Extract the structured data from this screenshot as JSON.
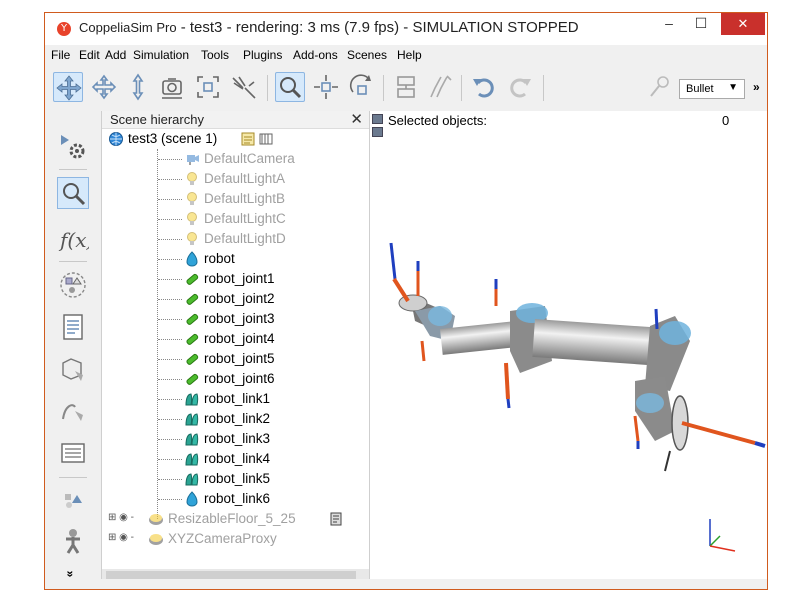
{
  "window": {
    "app_name": "CoppeliaSim Pro",
    "title_rest": " - test3 - rendering: 3 ms (7.9 fps) - SIMULATION STOPPED",
    "minimize": "–",
    "maximize": "☐",
    "close": "✕"
  },
  "menu": [
    "File",
    "Edit",
    "Add",
    "Simulation",
    "Tools",
    "Plugins",
    "Add-ons",
    "Scenes",
    "Help"
  ],
  "toolbar": {
    "icons": [
      "camera-pan-icon",
      "camera-rotate-icon",
      "camera-shift-icon",
      "camera-angle-icon",
      "fit-to-view-icon",
      "assemble-icon",
      "object-selection-icon",
      "object-shift-icon",
      "object-rotate-icon",
      "assemble-disassemble-icon",
      "transfer-dna-icon",
      "undo-icon",
      "redo-icon",
      "verify-icon"
    ],
    "engine": "Bullet",
    "overflow": "»"
  },
  "left_toolbar": {
    "icons": [
      "simulation-settings-icon",
      "selection-icon",
      "script-icon",
      "shape-edit-icon",
      "page-icon",
      "model-browser-icon",
      "path-icon",
      "scene-object-properties-icon",
      "collections-icon",
      "calculation-module-icon"
    ],
    "more": "»"
  },
  "hierarchy": {
    "title": "Scene hierarchy",
    "close": "✕",
    "scene_label": "test3 (scene 1)",
    "items": [
      {
        "label": "DefaultCamera",
        "type": "camera",
        "muted": true
      },
      {
        "label": "DefaultLightA",
        "type": "light",
        "muted": true
      },
      {
        "label": "DefaultLightB",
        "type": "light",
        "muted": true
      },
      {
        "label": "DefaultLightC",
        "type": "light",
        "muted": true
      },
      {
        "label": "DefaultLightD",
        "type": "light",
        "muted": true
      },
      {
        "label": "robot",
        "type": "shape",
        "muted": false
      },
      {
        "label": "robot_joint1",
        "type": "joint",
        "muted": false
      },
      {
        "label": "robot_joint2",
        "type": "joint",
        "muted": false
      },
      {
        "label": "robot_joint3",
        "type": "joint",
        "muted": false
      },
      {
        "label": "robot_joint4",
        "type": "joint",
        "muted": false
      },
      {
        "label": "robot_joint5",
        "type": "joint",
        "muted": false
      },
      {
        "label": "robot_joint6",
        "type": "joint",
        "muted": false
      },
      {
        "label": "robot_link1",
        "type": "link",
        "muted": false
      },
      {
        "label": "robot_link2",
        "type": "link",
        "muted": false
      },
      {
        "label": "robot_link3",
        "type": "link",
        "muted": false
      },
      {
        "label": "robot_link4",
        "type": "link",
        "muted": false
      },
      {
        "label": "robot_link5",
        "type": "link",
        "muted": false
      },
      {
        "label": "robot_link6",
        "type": "shape",
        "muted": false
      },
      {
        "label": "ResizableFloor_5_25",
        "type": "model",
        "muted": true
      },
      {
        "label": "XYZCameraProxy",
        "type": "model",
        "muted": true
      }
    ]
  },
  "viewport": {
    "selected_label": "Selected objects:",
    "selected_count": "0"
  },
  "colors": {
    "muted_text": "#a0a0a0",
    "close_button": "#c9302c",
    "selected_tool": "#d6e9fb"
  }
}
